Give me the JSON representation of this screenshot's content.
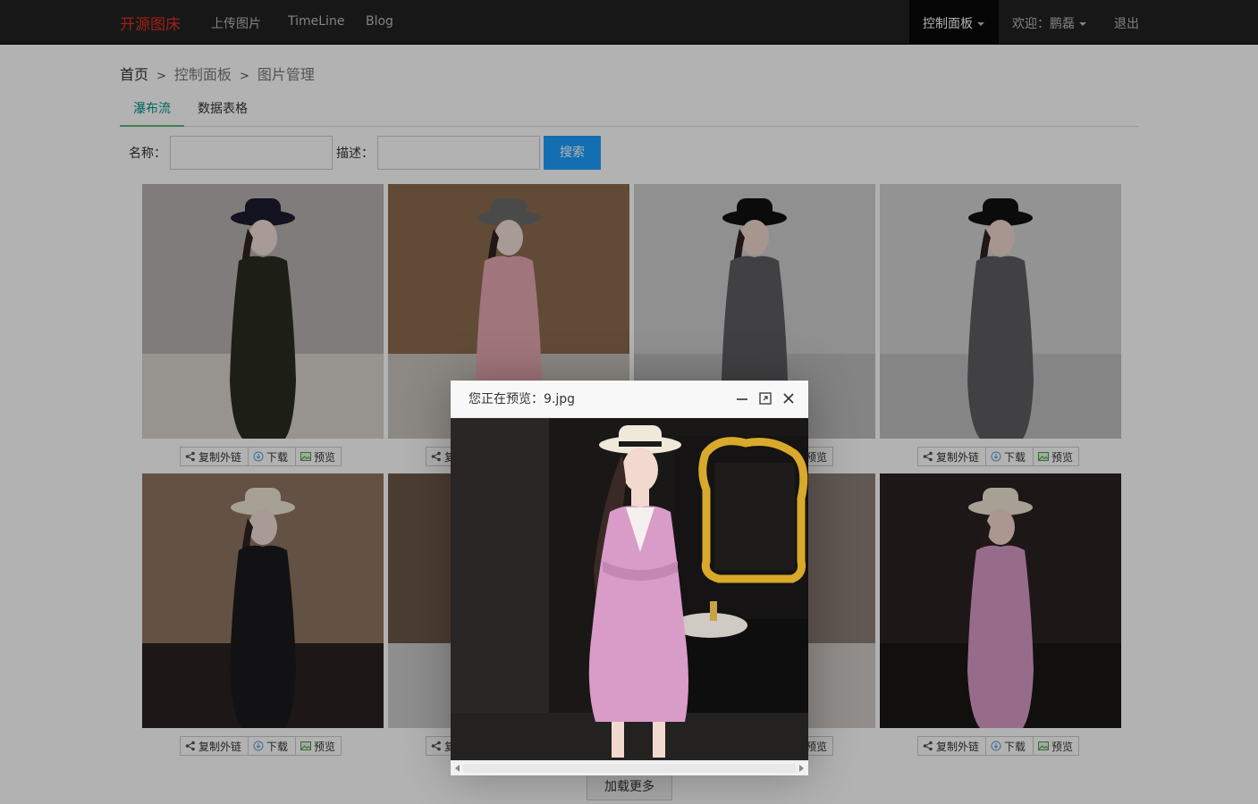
{
  "navbar": {
    "brand": "开源图床",
    "links": [
      "上传图片",
      "TimeLine",
      "Blog"
    ],
    "control_panel": "控制面板",
    "welcome": "欢迎：鹏磊",
    "logout": "退出"
  },
  "breadcrumb": {
    "home": "首页",
    "sep": ">",
    "panel": "控制面板",
    "current": "图片管理"
  },
  "tabs": [
    "瀑布流",
    "数据表格"
  ],
  "search": {
    "name_label": "名称：",
    "desc_label": "描述：",
    "button": "搜索"
  },
  "card_buttons": {
    "copy": "复制外链",
    "download": "下载",
    "preview": "预览"
  },
  "load_more": "加载更多",
  "modal": {
    "title": "您正在预览：9.jpg"
  },
  "colors": {
    "brand": "#e0301e",
    "tab_active": "#009688",
    "button_primary": "#1E9FFF"
  },
  "icons": [
    "share-icon",
    "download-icon",
    "image-icon",
    "minimize-icon",
    "maximize-icon",
    "close-icon"
  ]
}
